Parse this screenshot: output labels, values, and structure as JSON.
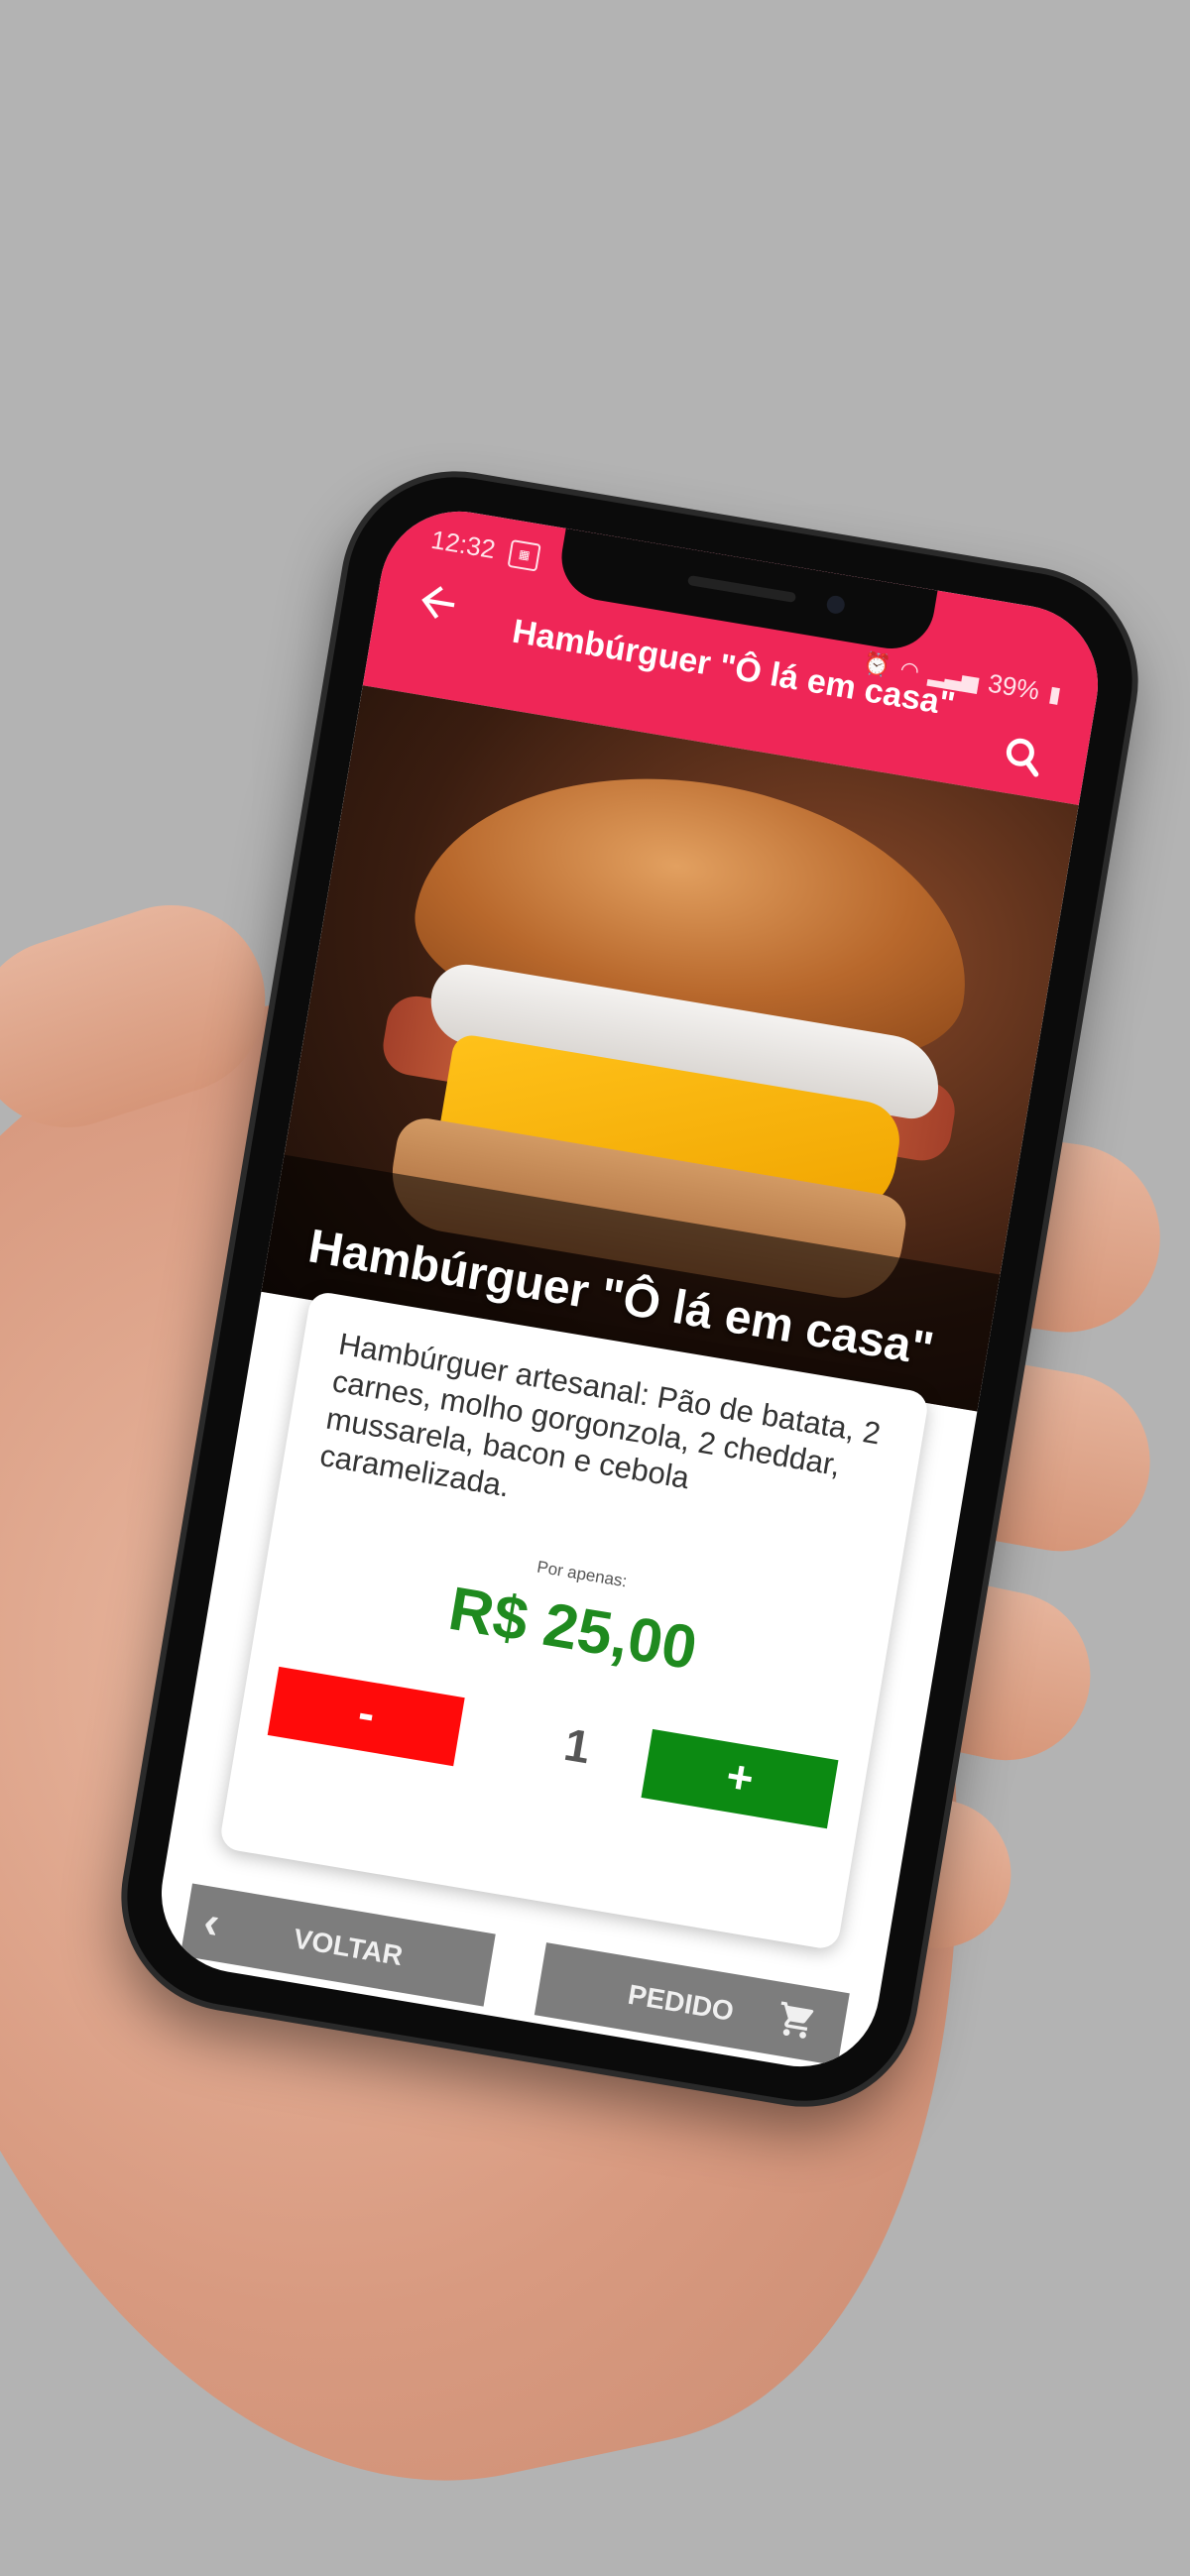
{
  "status_bar": {
    "time": "12:32",
    "battery": "39%"
  },
  "app_bar": {
    "title": "Hambúrguer \"Ô lá em casa\"",
    "back_icon": "arrow-left-icon",
    "search_icon": "search-icon",
    "color": "#ef2657"
  },
  "product": {
    "hero_title": "Hambúrguer \"Ô lá em casa\"",
    "description": "Hambúrguer artesanal: Pão de batata, 2 carnes, molho gorgonzola, 2 cheddar, mussarela, bacon e cebola caramelizada.",
    "price_label": "Por apenas:",
    "price": "R$ 25,00",
    "price_color": "#1f8a1f"
  },
  "quantity": {
    "minus_label": "-",
    "value": "1",
    "plus_label": "+",
    "minus_color": "#ff0a0a",
    "plus_color": "#0c8a12"
  },
  "actions": {
    "back_label": "VOLTAR",
    "order_label": "PEDIDO",
    "order_icon": "cart-icon"
  }
}
